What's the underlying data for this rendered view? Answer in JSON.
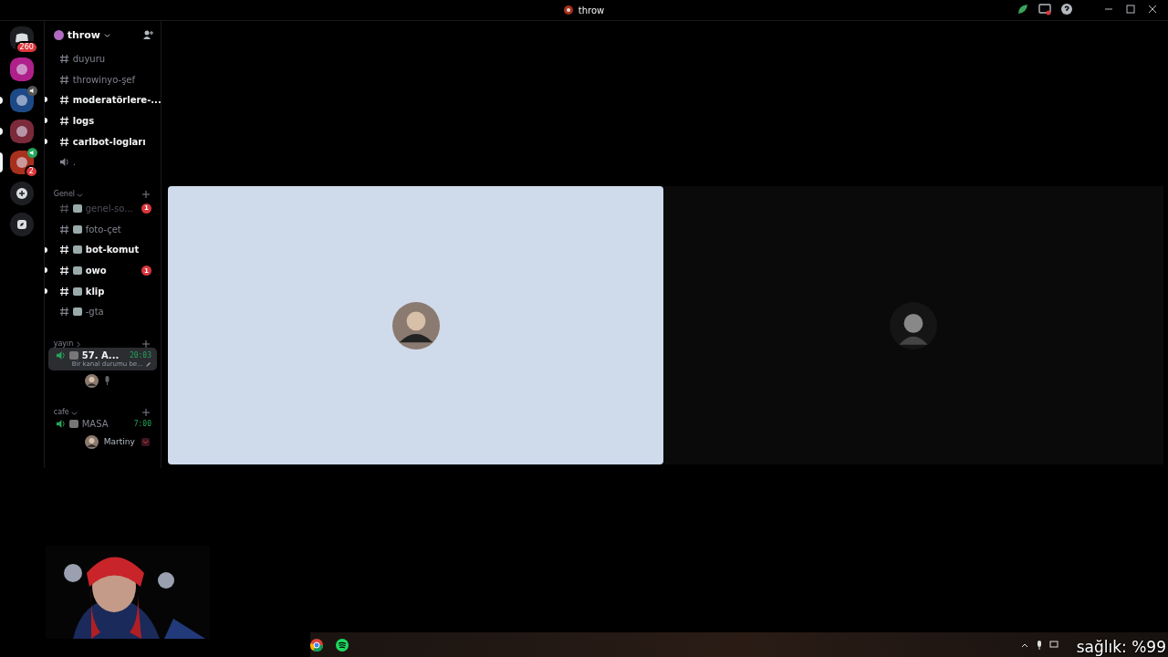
{
  "title_bar": {
    "title": "throw"
  },
  "servers": [
    {
      "kind": "home",
      "badge": "260",
      "unread": false,
      "speaking": false,
      "selected": false
    },
    {
      "kind": "server",
      "unread": false,
      "speaking": false,
      "selected": false
    },
    {
      "kind": "server",
      "unread": true,
      "speaking": true,
      "selected": false
    },
    {
      "kind": "server",
      "unread": true,
      "speaking": false,
      "selected": false
    },
    {
      "kind": "server",
      "badge": "2",
      "unread": false,
      "speaking": true,
      "selected": true
    }
  ],
  "channel_list": {
    "server_name": "throw",
    "sections": [
      {
        "channels": [
          {
            "kind": "text",
            "name": "duyuru",
            "unread": false,
            "emoji": false
          },
          {
            "kind": "text",
            "name": "throwinyo-şef",
            "unread": false,
            "emoji": false
          },
          {
            "kind": "text",
            "name": "moderatörlere-...",
            "unread": true,
            "emoji": false
          },
          {
            "kind": "text",
            "name": "logs",
            "unread": true,
            "emoji": false
          },
          {
            "kind": "text",
            "name": "carlbot-logları",
            "unread": true,
            "emoji": false
          },
          {
            "kind": "voice",
            "name": ".",
            "unread": false,
            "emoji": false
          }
        ]
      },
      {
        "name": "Genel",
        "expanded": true,
        "channels": [
          {
            "kind": "text",
            "name": "genel-so...",
            "unread": false,
            "muted": true,
            "emoji": true,
            "badge": "1"
          },
          {
            "kind": "text",
            "name": "foto-çet",
            "unread": false,
            "emoji": true
          },
          {
            "kind": "text",
            "name": "bot-komut",
            "unread": true,
            "emoji": true
          },
          {
            "kind": "text",
            "name": "owo",
            "unread": true,
            "emoji": true,
            "badge": "1"
          },
          {
            "kind": "text",
            "name": "klip",
            "unread": true,
            "emoji": true
          },
          {
            "kind": "text",
            "name": "-gta",
            "unread": false,
            "emoji": true
          }
        ]
      },
      {
        "name": "yayın",
        "expanded": false,
        "channels": [
          {
            "kind": "voice",
            "name": "57. A...",
            "unread": true,
            "emoji": true,
            "selected": true,
            "time": "20:03",
            "status": "Bir kanal durumu be...",
            "users": [
              {
                "mic": true
              }
            ]
          }
        ]
      },
      {
        "name": "cafe",
        "expanded": true,
        "channels": [
          {
            "kind": "voice",
            "name": "MASA",
            "unread": false,
            "emoji": true,
            "selected": false,
            "time": "7:00",
            "users": [
              {
                "name": "Martiny",
                "mic": false,
                "badge_icon": true
              }
            ]
          }
        ]
      }
    ]
  },
  "tiles": [
    {
      "kind": "light"
    },
    {
      "kind": "dark"
    }
  ],
  "overlay_text": "sağlık: %99"
}
